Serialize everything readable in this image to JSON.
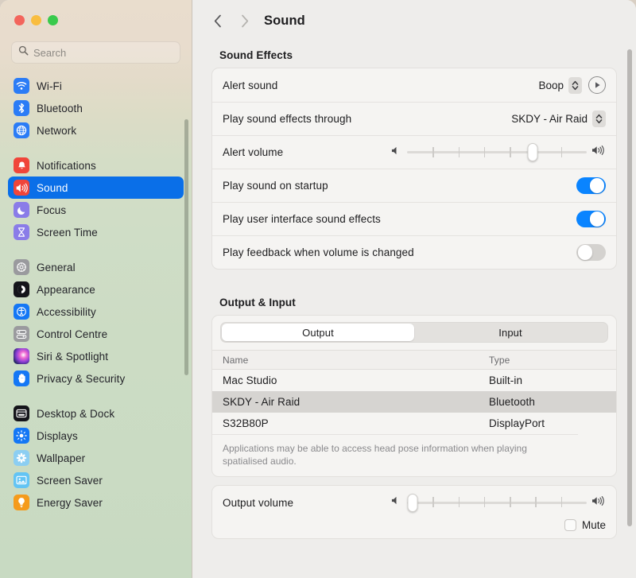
{
  "window": {
    "traffic_lights": [
      "close",
      "minimize",
      "zoom"
    ],
    "colors": {
      "close": "#f3655c",
      "minimize": "#f9bd3f",
      "zoom": "#39ca4c",
      "accent": "#0a84ff",
      "selected_nav": "#0a6fe8"
    }
  },
  "search": {
    "placeholder": "Search",
    "value": ""
  },
  "sidebar": {
    "groups": [
      {
        "items": [
          {
            "label": "Wi-Fi",
            "icon": "wifi-icon",
            "selected": false
          },
          {
            "label": "Bluetooth",
            "icon": "bluetooth-icon",
            "selected": false
          },
          {
            "label": "Network",
            "icon": "network-globe-icon",
            "selected": false
          }
        ]
      },
      {
        "items": [
          {
            "label": "Notifications",
            "icon": "notifications-bell-icon",
            "selected": false
          },
          {
            "label": "Sound",
            "icon": "sound-speaker-icon",
            "selected": true
          },
          {
            "label": "Focus",
            "icon": "focus-moon-icon",
            "selected": false
          },
          {
            "label": "Screen Time",
            "icon": "screen-time-hourglass-icon",
            "selected": false
          }
        ]
      },
      {
        "items": [
          {
            "label": "General",
            "icon": "general-gear-icon",
            "selected": false
          },
          {
            "label": "Appearance",
            "icon": "appearance-contrast-icon",
            "selected": false
          },
          {
            "label": "Accessibility",
            "icon": "accessibility-person-icon",
            "selected": false
          },
          {
            "label": "Control Centre",
            "icon": "control-centre-sliders-icon",
            "selected": false
          },
          {
            "label": "Siri & Spotlight",
            "icon": "siri-orb-icon",
            "selected": false
          },
          {
            "label": "Privacy & Security",
            "icon": "privacy-hand-icon",
            "selected": false
          }
        ]
      },
      {
        "items": [
          {
            "label": "Desktop & Dock",
            "icon": "desktop-dock-icon",
            "selected": false
          },
          {
            "label": "Displays",
            "icon": "displays-brightness-icon",
            "selected": false
          },
          {
            "label": "Wallpaper",
            "icon": "wallpaper-flower-icon",
            "selected": false
          },
          {
            "label": "Screen Saver",
            "icon": "screen-saver-icon",
            "selected": false
          },
          {
            "label": "Energy Saver",
            "icon": "energy-saver-bulb-icon",
            "selected": false
          }
        ]
      }
    ]
  },
  "toolbar": {
    "back": "‹",
    "forward": "›",
    "title": "Sound"
  },
  "sound_effects": {
    "section_title": "Sound Effects",
    "alert_sound": {
      "label": "Alert sound",
      "value": "Boop"
    },
    "play_through": {
      "label": "Play sound effects through",
      "value": "SKDY - Air Raid"
    },
    "alert_volume": {
      "label": "Alert volume",
      "value_percent": 70,
      "tick_count": 6
    },
    "toggles": [
      {
        "label": "Play sound on startup",
        "on": true
      },
      {
        "label": "Play user interface sound effects",
        "on": true
      },
      {
        "label": "Play feedback when volume is changed",
        "on": false
      }
    ]
  },
  "output_input": {
    "section_title": "Output & Input",
    "tabs": [
      {
        "label": "Output",
        "active": true
      },
      {
        "label": "Input",
        "active": false
      }
    ],
    "columns": [
      "Name",
      "Type"
    ],
    "rows": [
      {
        "name": "Mac Studio",
        "type": "Built-in",
        "selected": false
      },
      {
        "name": "SKDY - Air Raid",
        "type": "Bluetooth",
        "selected": true
      },
      {
        "name": "S32B80P",
        "type": "DisplayPort",
        "selected": false
      }
    ],
    "note": "Applications may be able to access head pose information when playing spatialised audio.",
    "output_volume": {
      "label": "Output volume",
      "value_percent": 3,
      "tick_count": 6
    },
    "mute": {
      "label": "Mute",
      "checked": false
    }
  }
}
